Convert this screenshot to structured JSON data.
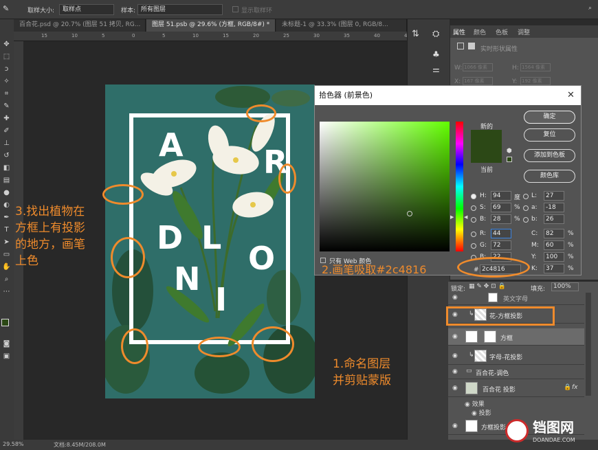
{
  "options_bar": {
    "sample_size_label": "取样大小:",
    "sample_size_value": "取样点",
    "sample_label": "样本:",
    "sample_value": "所有图层",
    "show_ring_label": "显示取样环"
  },
  "tabs": [
    {
      "label": "百合花.psd @ 20.7% (图层 51 拷贝, RG..."
    },
    {
      "label": "图层 51.psb @ 29.6% (方框, RGB/8#) *"
    },
    {
      "label": "未标题-1 @ 33.3% (图层 0, RGB/8..."
    }
  ],
  "ruler_numbers": [
    "15",
    "10",
    "5",
    "0",
    "5",
    "10",
    "15",
    "20",
    "25",
    "30",
    "35",
    "40",
    "45"
  ],
  "poster": {
    "letters": [
      "A",
      "R",
      "D",
      "L",
      "O",
      "N",
      "I"
    ]
  },
  "color_picker": {
    "title": "拾色器 (前景色)",
    "new_label": "新的",
    "current_label": "当前",
    "new_color": "#2c4816",
    "current_color": "#2c4816",
    "buttons": {
      "ok": "确定",
      "reset": "复位",
      "add_swatch": "添加到色板",
      "libraries": "颜色库"
    },
    "only_web": "只有 Web 颜色",
    "fields": {
      "H": "94",
      "H_unit": "度",
      "S": "69",
      "S_unit": "%",
      "B": "28",
      "B_unit": "%",
      "R": "44",
      "G": "72",
      "B2": "22",
      "L": "27",
      "a": "-18",
      "b": "26",
      "C": "82",
      "M": "60",
      "Y": "100",
      "K": "37",
      "pct": "%"
    },
    "hex_label": "#",
    "hex_value": "2c4816"
  },
  "properties_panel": {
    "tabs": [
      "属性",
      "颜色",
      "色板",
      "调整"
    ],
    "subtitle": "实时形状属性",
    "w_label": "W:",
    "h_label": "H:",
    "x_label": "X:",
    "y_label": "Y:",
    "w_value": "1066 像素",
    "h_value": "1564 像素",
    "x_value": "167 像素",
    "y_value": "192 像素"
  },
  "layers": {
    "lock_label": "锁定:",
    "fill_label": "填充:",
    "fill_value": "100%",
    "rows": [
      {
        "name": "英文字母"
      },
      {
        "name": "花-方框投影"
      },
      {
        "name": "方框"
      },
      {
        "name": "字母-花投影"
      },
      {
        "name": "百合花-调色"
      },
      {
        "name": "百合花 投影"
      },
      {
        "name": "效果"
      },
      {
        "name": "投影"
      },
      {
        "name": "方框投影"
      }
    ]
  },
  "annotations": {
    "step1_line1": "1.命名图层",
    "step1_line2": "并剪贴蒙版",
    "step2": "2.画笔吸取#2c4816",
    "step3_line1": "3.找出植物在",
    "step3_line2": "方框上有投影",
    "step3_line3": "的地方，画笔",
    "step3_line4": "上色"
  },
  "status_bar": {
    "zoom": "29.58%",
    "doc": "文档:8.45M/208.0M"
  },
  "watermark": {
    "brand": "铛图网",
    "sub": "DOANDAE.COM"
  },
  "colors": {
    "annotation": "#ef8b2c",
    "poster_bg": "#2f6e69"
  }
}
